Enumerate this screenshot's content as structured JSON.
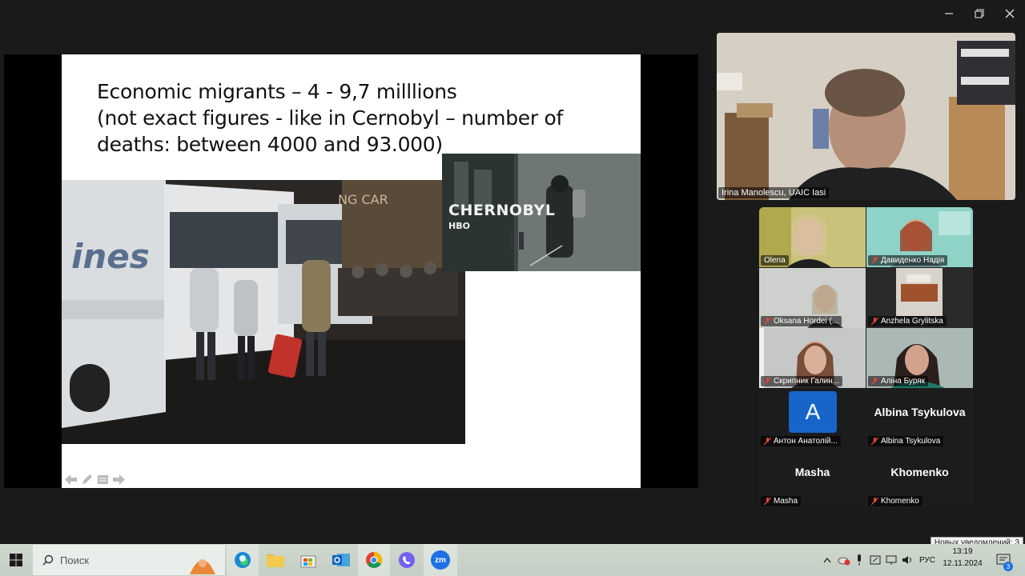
{
  "window": {
    "minimize": "–",
    "restore": "❐",
    "close": "✕"
  },
  "slide": {
    "title_lines": [
      "Economic migrants – 4 - 9,7 milllions",
      "(not exact figures - like in Cernobyl – number of",
      "deaths: between 4000 and 93.000)"
    ],
    "chernobyl_title": "CHERNOBYL",
    "chernobyl_sub": "HBO"
  },
  "speaker": {
    "name": "Irina Manolescu, UAIC Iasi"
  },
  "gallery": {
    "tiles": [
      {
        "name": "Olena",
        "muted": false
      },
      {
        "name": "Давиденко Надія",
        "muted": true
      },
      {
        "name": "Oksana Hordei (...",
        "muted": true
      },
      {
        "name": "Anzhela Grylitska",
        "muted": true
      },
      {
        "name": "Скрипник Галин...",
        "muted": true
      },
      {
        "name": "Аліна Буряк",
        "muted": true
      },
      {
        "name": "Антон Анатолій...",
        "muted": true,
        "avatar": "A"
      },
      {
        "name": "Albina Tsykulova",
        "muted": true,
        "bigname": "Albina Tsykulova"
      },
      {
        "name": "Masha",
        "muted": true,
        "bigname": "Masha"
      },
      {
        "name": "Khomenko",
        "muted": true,
        "bigname": "Khomenko"
      }
    ]
  },
  "taskbar": {
    "search_placeholder": "Поиск",
    "lang": "РУС",
    "time": "13:19",
    "date": "12.11.2024",
    "notifications_count": "3",
    "notifications_tip": "Новых уведомлений: 3",
    "zoom_label": "zm"
  },
  "colors": {
    "accent": "#1765c9",
    "muted_red": "#e0443b",
    "taskbar": "#c9d3c8"
  }
}
